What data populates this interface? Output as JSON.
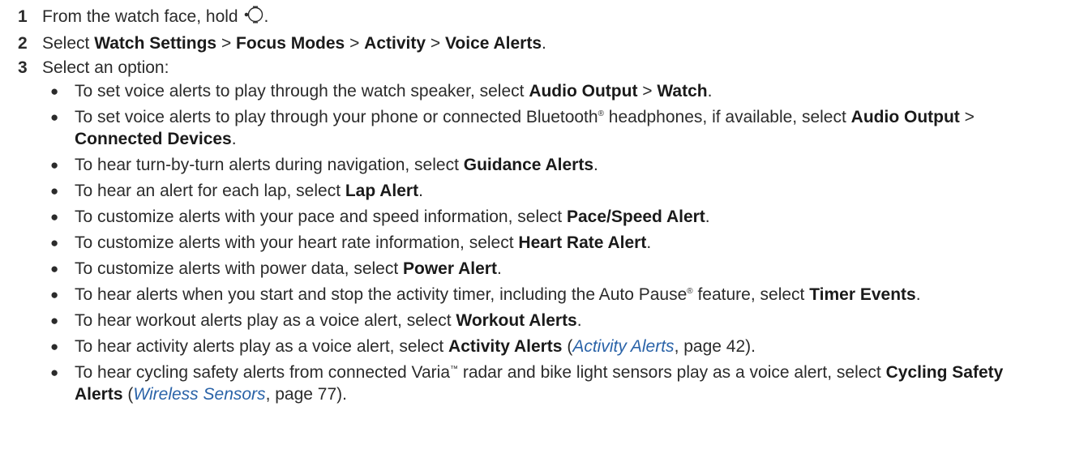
{
  "steps": [
    {
      "num": "1",
      "pre": "From the watch face, hold ",
      "icon": "watch-button-icon",
      "post": "."
    },
    {
      "num": "2",
      "pre": "Select ",
      "b1": "Watch Settings",
      "sep1": " > ",
      "b2": "Focus Modes",
      "sep2": " > ",
      "b3": "Activity",
      "sep3": " > ",
      "b4": "Voice Alerts",
      "post": "."
    },
    {
      "num": "3",
      "text": "Select an option:"
    }
  ],
  "bullet_glyph": "●",
  "options": [
    {
      "t1": "To set voice alerts to play through the watch speaker, select ",
      "b1": "Audio Output",
      "t2": " > ",
      "b2": "Watch",
      "t3": "."
    },
    {
      "t1": "To set voice alerts to play through your phone or connected Bluetooth",
      "sup": "®",
      "t2": " headphones, if available, select ",
      "b1": "Audio Output",
      "t3": " > ",
      "b2": "Connected Devices",
      "t4": "."
    },
    {
      "t1": "To hear turn-by-turn alerts during navigation, select ",
      "b1": "Guidance Alerts",
      "t2": "."
    },
    {
      "t1": "To hear an alert for each lap, select ",
      "b1": "Lap Alert",
      "t2": "."
    },
    {
      "t1": "To customize alerts with your pace and speed information, select ",
      "b1": "Pace/Speed Alert",
      "t2": "."
    },
    {
      "t1": "To customize alerts with your heart rate information, select ",
      "b1": "Heart Rate Alert",
      "t2": "."
    },
    {
      "t1": "To customize alerts with power data, select ",
      "b1": "Power Alert",
      "t2": "."
    },
    {
      "t1": "To hear alerts when you start and stop the activity timer, including the Auto Pause",
      "sup": "®",
      "t2": " feature, select ",
      "b1": "Timer Events",
      "t3": "."
    },
    {
      "t1": "To hear workout alerts play as a voice alert, select ",
      "b1": "Workout Alerts",
      "t2": "."
    },
    {
      "t1": "To hear activity alerts play as a voice alert, select ",
      "b1": "Activity Alerts",
      "t2": " (",
      "link": "Activity Alerts",
      "t3": ", page 42)."
    },
    {
      "t1": "To hear cycling safety alerts from connected Varia",
      "sup": "™",
      "t2": " radar and bike light sensors play as a voice alert, select ",
      "b1": "Cycling Safety Alerts",
      "t3": " (",
      "link": "Wireless Sensors",
      "t4": ", page 77)."
    }
  ],
  "colors": {
    "text": "#2b2b2b",
    "link": "#2a63a8"
  }
}
